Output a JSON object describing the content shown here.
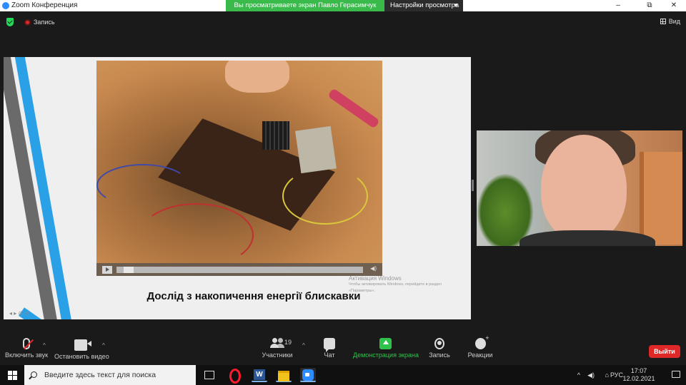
{
  "window": {
    "title": "Zoom Конференция",
    "share_banner": "Вы просматриваете экран Павло Герасимчук",
    "view_options": "Настройки просмотра",
    "controls": {
      "minimize": "–",
      "maximize": "⧉",
      "close": "✕"
    }
  },
  "meeting_bar": {
    "recording_label": "Запись",
    "view_label": "Вид"
  },
  "shared_screen": {
    "caption": "Дослід з накопичення енергії блискавки",
    "watermark_line1": "Активация Windows",
    "watermark_line2": "Чтобы активировать Windows, перейдите в раздел «Параметры».",
    "video_progress": 0.03
  },
  "toolbar": {
    "mute_label": "Включить звук",
    "video_label": "Остановить видео",
    "participants_label": "Участники",
    "participants_count": "19",
    "chat_label": "Чат",
    "share_label": "Демонстрация экрана",
    "record_label": "Запись",
    "reactions_label": "Реакции",
    "leave_label": "Выйти",
    "caret": "^"
  },
  "taskbar": {
    "search_placeholder": "Введите здесь текст для поиска",
    "tray_arrow": "^",
    "language": "РУС",
    "time": "17:07",
    "date": "12.02.2021"
  },
  "colors": {
    "accent_green": "#2fc24b",
    "zoom_blue": "#2d8cff",
    "leave_red": "#e02828"
  }
}
